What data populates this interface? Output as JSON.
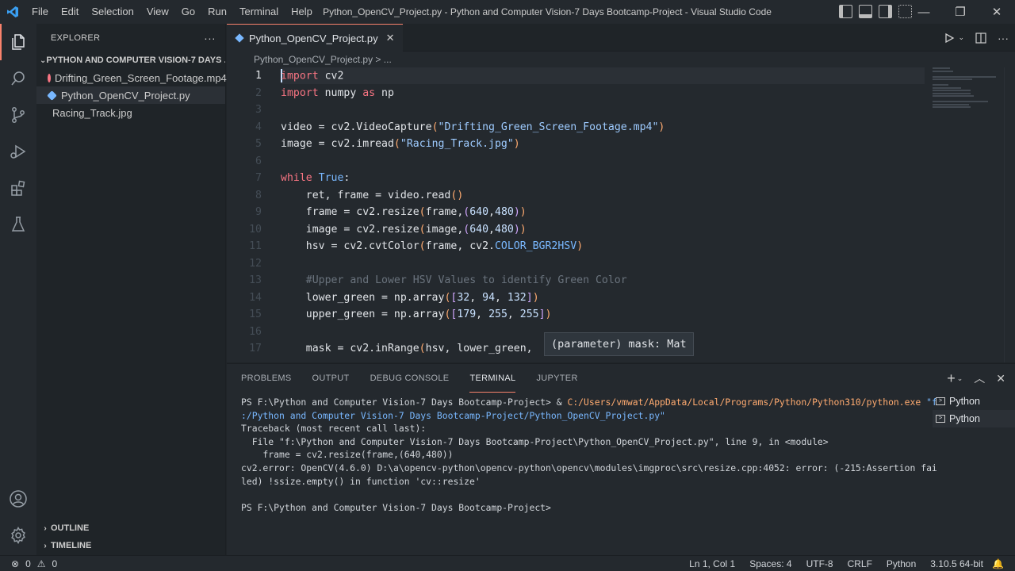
{
  "menu": [
    "File",
    "Edit",
    "Selection",
    "View",
    "Go",
    "Run",
    "Terminal",
    "Help"
  ],
  "window_title": "Python_OpenCV_Project.py - Python and Computer Vision-7 Days Bootcamp-Project - Visual Studio Code",
  "window_controls": {
    "minimize": "—",
    "maximize": "❐",
    "close": "✕"
  },
  "sidebar": {
    "title": "EXPLORER",
    "more": "···",
    "folder": "PYTHON AND COMPUTER VISION-7 DAYS ...",
    "files": [
      {
        "name": "Drifting_Green_Screen_Footage.mp4",
        "icon_color": "#f97583"
      },
      {
        "name": "Python_OpenCV_Project.py",
        "icon_color": "#79b8ff"
      },
      {
        "name": "Racing_Track.jpg",
        "icon_color": ""
      }
    ],
    "outline": "OUTLINE",
    "timeline": "TIMELINE"
  },
  "editor": {
    "tab_label": "Python_OpenCV_Project.py",
    "tab_close": "✕",
    "breadcrumb_file": "Python_OpenCV_Project.py",
    "breadcrumb_rest": " > ...",
    "line_numbers": [
      "1",
      "2",
      "3",
      "4",
      "5",
      "6",
      "7",
      "8",
      "9",
      "10",
      "11",
      "12",
      "13",
      "14",
      "15",
      "16",
      "17"
    ],
    "hover_text": "(parameter) mask: Mat"
  },
  "panel": {
    "tabs": [
      "PROBLEMS",
      "OUTPUT",
      "DEBUG CONSOLE",
      "TERMINAL",
      "JUPYTER"
    ],
    "active_tab": "TERMINAL",
    "terminal_lines": [
      "PS F:\\Python and Computer Vision-7 Days Bootcamp-Project> & ",
      "C:/Users/vmwat/AppData/Local/Programs/Python/Python310/python.exe",
      " \"f",
      ":/Python and Computer Vision-7 Days Bootcamp-Project/Python_OpenCV_Project.py\"",
      "Traceback (most recent call last):",
      "  File \"f:\\Python and Computer Vision-7 Days Bootcamp-Project\\Python_OpenCV_Project.py\", line 9, in <module>",
      "    frame = cv2.resize(frame,(640,480))",
      "cv2.error: OpenCV(4.6.0) D:\\a\\opencv-python\\opencv-python\\opencv\\modules\\imgproc\\src\\resize.cpp:4052: error: (-215:Assertion fai",
      "led) !ssize.empty() in function 'cv::resize'",
      "",
      "PS F:\\Python and Computer Vision-7 Days Bootcamp-Project> "
    ],
    "terminals": [
      "Python",
      "Python"
    ]
  },
  "status": {
    "errors": "0",
    "warnings": "0",
    "position": "Ln 1, Col 1",
    "spaces": "Spaces: 4",
    "encoding": "UTF-8",
    "eol": "CRLF",
    "language": "Python",
    "interpreter": "3.10.5 64-bit"
  }
}
